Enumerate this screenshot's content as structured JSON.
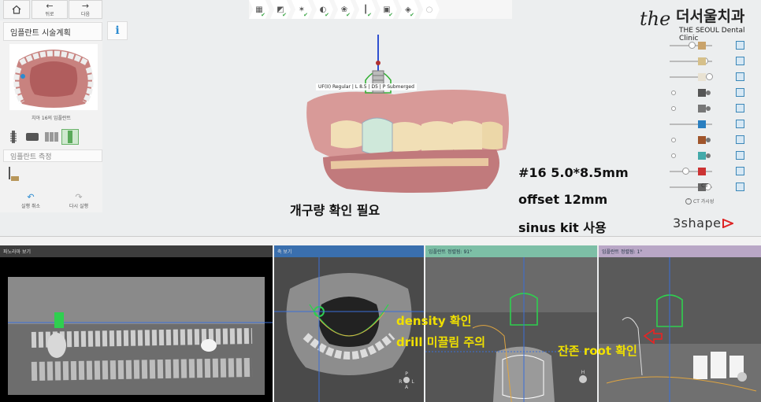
{
  "nav": {
    "home_icon": "home-icon",
    "back_label": "뒤로",
    "next_label": "다음"
  },
  "left_panel": {
    "planning_title": "임플란트 시술계획",
    "info_label": "i",
    "tooth_caption": "치아 16의 임플란트",
    "measure_title": "임플란트 측정",
    "undo_label": "실행 취소",
    "redo_label": "다시 실행"
  },
  "steps": [
    {
      "icon": "scan-step-icon",
      "done": true
    },
    {
      "icon": "align-step-icon",
      "done": true
    },
    {
      "icon": "nerve-step-icon",
      "done": true
    },
    {
      "icon": "crown-step-icon",
      "done": true
    },
    {
      "icon": "tooth-step-icon",
      "done": true
    },
    {
      "icon": "implant-step-icon",
      "done": true
    },
    {
      "icon": "sleeve-step-icon",
      "done": true
    },
    {
      "icon": "guide-step-icon",
      "done": true
    },
    {
      "icon": "export-step-icon",
      "done": false
    }
  ],
  "logo": {
    "name_kr": "더서울치과",
    "name_en": "THE SEOUL Dental Clinic",
    "monogram": "the"
  },
  "right_panel": {
    "ct_label": "CT",
    "ct_visible_label": "CT 가시성",
    "brand": "3shape"
  },
  "implant_label": "UF(II) Regular | L 8.5 | D5 | P Submerged",
  "annotations": {
    "spec": "#16 5.0*8.5mm",
    "offset": "offset 12mm",
    "sinus": "sinus kit 사용",
    "opening": "개구량 확인 필요",
    "density": "density 확인",
    "drill": "drill 미끌림 주의",
    "root": "잔존 root 확인"
  },
  "views": {
    "panorama_title": "파노라마 보기",
    "axial_title": "축 보기",
    "cross1_title": "임플란트 정렬됨: 91°",
    "cross2_title": "임플란트 정렬됨: 1°"
  },
  "orientation": {
    "top": "P",
    "left": "R",
    "right": "L",
    "bottom": "A",
    "h": "H"
  },
  "colors": {
    "accent_blue": "#2c8bd0",
    "check_green": "#3aa545",
    "annotation_yellow": "#f0e000",
    "panorama_bar": "#3d3d3d",
    "axial_bar": "#3a6fae",
    "cross1_bar": "#7dbfa6",
    "cross2_bar": "#b9a7c6"
  }
}
